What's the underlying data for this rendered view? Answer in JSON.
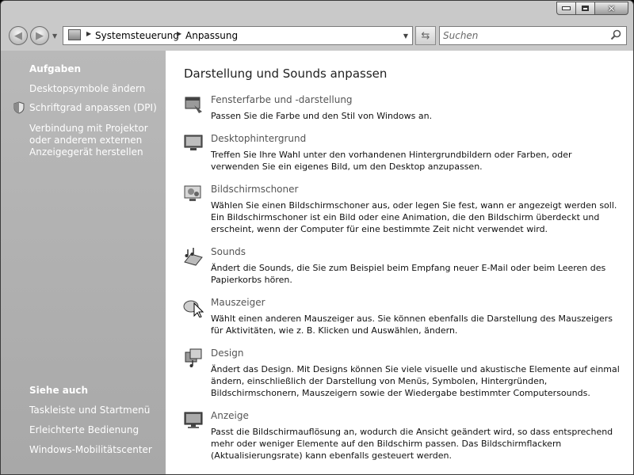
{
  "window": {
    "caption_buttons": {
      "minimize_icon": "minimize-icon",
      "maximize_icon": "maximize-icon",
      "close_icon": "close-icon"
    }
  },
  "navbar": {
    "back_icon": "back-arrow-icon",
    "forward_icon": "forward-arrow-icon",
    "breadcrumb": [
      "Systemsteuerung",
      "Anpassung"
    ],
    "refresh_icon": "refresh-icon",
    "search_placeholder": "Suchen",
    "search_icon": "magnifier-icon"
  },
  "sidebar": {
    "tasks_heading": "Aufgaben",
    "tasks": [
      {
        "label": "Desktopsymbole ändern"
      },
      {
        "label": "Schriftgrad anpassen (DPI)",
        "icon": "shield-icon"
      },
      {
        "label": "Verbindung mit Projektor oder anderem externen Anzeigegerät herstellen"
      }
    ],
    "see_also_heading": "Siehe auch",
    "see_also": [
      {
        "label": "Taskleiste und Startmenü"
      },
      {
        "label": "Erleichterte Bedienung"
      },
      {
        "label": "Windows-Mobilitätscenter"
      }
    ]
  },
  "main": {
    "title": "Darstellung und Sounds anpassen",
    "sections": [
      {
        "title": "Fensterfarbe und -darstellung",
        "desc": "Passen Sie die Farbe und den Stil von Windows an.",
        "icon": "window-color-icon"
      },
      {
        "title": "Desktophintergrund",
        "desc": "Treffen Sie Ihre Wahl unter den vorhandenen Hintergrundbildern oder Farben, oder verwenden Sie ein eigenes Bild, um den Desktop anzupassen.",
        "icon": "desktop-background-icon"
      },
      {
        "title": "Bildschirmschoner",
        "desc": "Wählen Sie einen Bildschirmschoner aus, oder legen Sie fest, wann er angezeigt werden soll. Ein Bildschirmschoner ist ein Bild oder eine Animation, die den Bildschirm überdeckt und erscheint, wenn der Computer für eine bestimmte Zeit nicht verwendet wird.",
        "icon": "screensaver-icon"
      },
      {
        "title": "Sounds",
        "desc": "Ändert die Sounds, die Sie zum Beispiel beim Empfang neuer E-Mail oder beim Leeren des Papierkorbs hören.",
        "icon": "sounds-icon"
      },
      {
        "title": "Mauszeiger",
        "desc": "Wählt einen anderen Mauszeiger aus. Sie können ebenfalls die Darstellung des Mauszeigers für Aktivitäten, wie z. B. Klicken und Auswählen, ändern.",
        "icon": "mouse-pointer-icon"
      },
      {
        "title": "Design",
        "desc": "Ändert das Design. Mit Designs können Sie viele visuelle und akustische Elemente auf einmal ändern, einschließlich der Darstellung von Menüs, Symbolen, Hintergründen, Bildschirmschonern, Mauszeigern sowie der Wiedergabe bestimmter Computersounds.",
        "icon": "theme-icon"
      },
      {
        "title": "Anzeige",
        "desc": "Passt die Bildschirmauflösung an, wodurch die Ansicht geändert wird, so dass entsprechend mehr oder weniger Elemente auf den Bildschirm passen. Das Bildschirmflackern (Aktualisierungsrate) kann ebenfalls gesteuert werden.",
        "icon": "display-settings-icon"
      }
    ]
  }
}
